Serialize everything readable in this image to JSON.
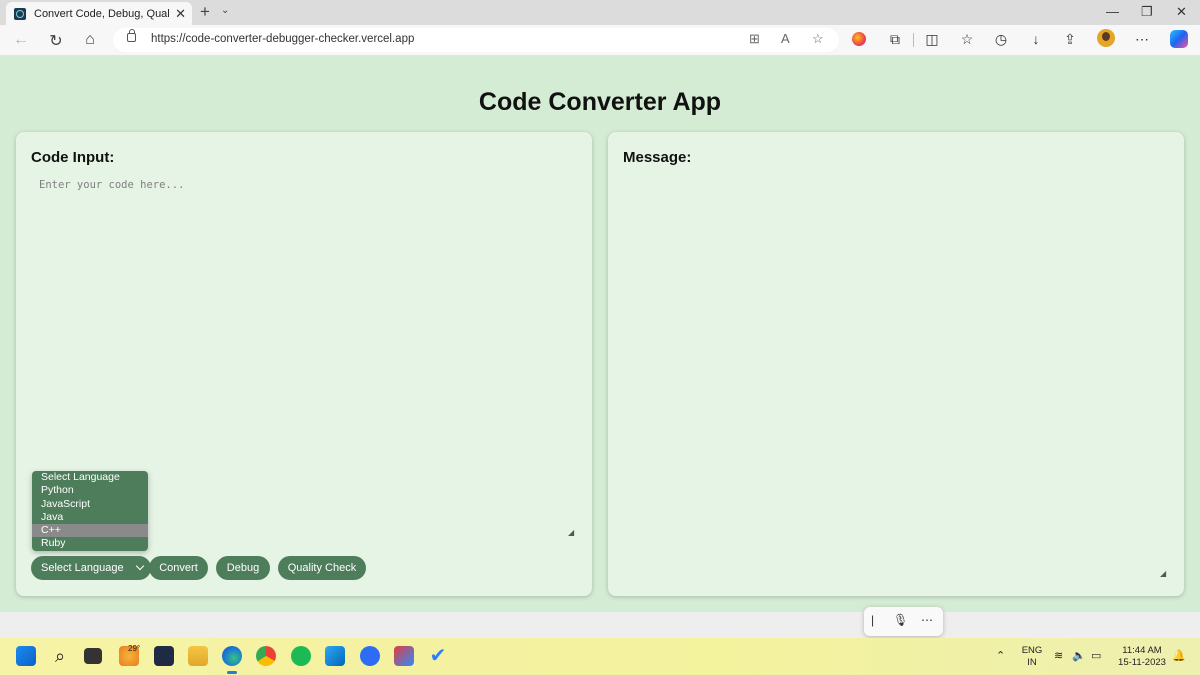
{
  "browser": {
    "tab_title": "Convert Code, Debug, Quality Ch",
    "url": "https://code-converter-debugger-checker.vercel.app"
  },
  "page": {
    "title": "Code Converter App",
    "code_label": "Code Input:",
    "code_placeholder": "Enter your code here...",
    "message_label": "Message:"
  },
  "controls": {
    "select_value": "Select Language",
    "options": [
      "Select Language",
      "Python",
      "JavaScript",
      "Java",
      "C++",
      "Ruby"
    ],
    "highlighted_option": "C++",
    "convert_label": "Convert",
    "debug_label": "Debug",
    "quality_label": "Quality Check"
  },
  "taskbar": {
    "weather_temp": "29°",
    "lang_line1": "ENG",
    "lang_line2": "IN",
    "time": "11:44 AM",
    "date": "15-11-2023"
  },
  "colors": {
    "page_bg": "#d5ecd4",
    "panel_bg": "#e6f4e6",
    "button_green": "#4e7d5b"
  }
}
